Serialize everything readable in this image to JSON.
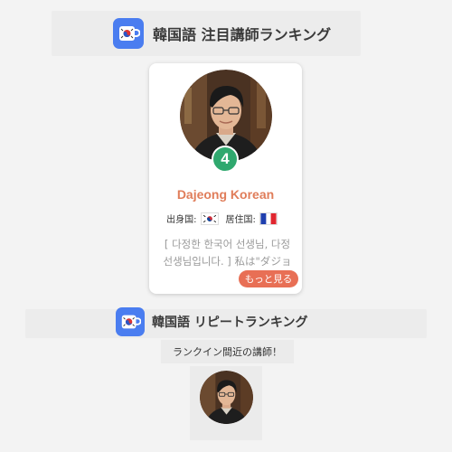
{
  "section_featured": {
    "title": "韓国語 注目講師ランキング",
    "icon": "korean-flag-cup-icon"
  },
  "teacher_card": {
    "rank": "4",
    "name": "Dajeong Korean",
    "origin_label": "出身国:",
    "origin_flag": "south-korea-flag-icon",
    "residence_label": "居住国:",
    "residence_flag": "france-flag-icon",
    "intro": "[ 다정한 한국어 선생님, 다정 선생님입니다. ] 私は\"ダジョン\"と申しま",
    "more_label": "もっと見る",
    "rank_badge_color": "#2fa86e",
    "name_color": "#e07d5a",
    "more_button_color": "#e86f55"
  },
  "section_repeat": {
    "title": "韓国語 リピートランキング",
    "icon": "korean-flag-cup-icon",
    "subtitle": "ランクイン間近の講師！"
  },
  "colors": {
    "app_icon": "#4a7df0",
    "background": "#f3f3f3"
  }
}
